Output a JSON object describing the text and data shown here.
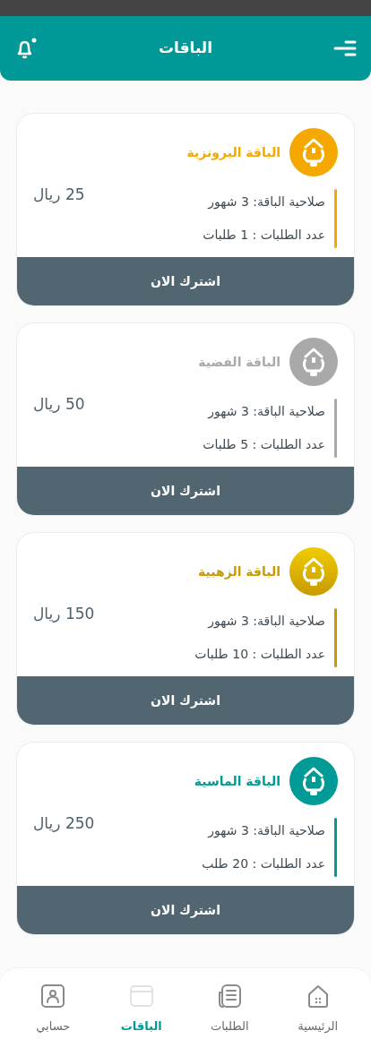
{
  "header": {
    "title": "الباقات"
  },
  "packages": [
    {
      "name": "الباقة البرونزية",
      "color": "#f5a800",
      "price": "25 ريال",
      "validity": "صلاحية الباقة: 3 شهور",
      "requests": "عدد الطلبات : 1 طلبات",
      "button": "اشترك الان"
    },
    {
      "name": "الباقة الفضية",
      "color": "#a9a9a9",
      "price": "50 ريال",
      "validity": "صلاحية الباقة: 3 شهور",
      "requests": "عدد الطلبات : 5 طلبات",
      "button": "اشترك الان"
    },
    {
      "name": "الباقة الزهبية",
      "color": "#c89a00",
      "price": "150 ريال",
      "validity": "صلاحية الباقة: 3 شهور",
      "requests": "عدد الطلبات : 10 طلبات",
      "button": "اشترك الان"
    },
    {
      "name": "الباقة الماسية",
      "color": "#009b96",
      "price": "250 ريال",
      "validity": "صلاحية الباقة: 3 شهور",
      "requests": "عدد الطلبات : 20 طلب",
      "button": "اشترك الان"
    }
  ],
  "nav": [
    {
      "kind": "home",
      "label": "الرئيسية",
      "selected": false
    },
    {
      "kind": "orders",
      "label": "الطلبات",
      "selected": false
    },
    {
      "kind": "packages",
      "label": "الباقات",
      "selected": true
    },
    {
      "kind": "account",
      "label": "حسابي",
      "selected": false
    }
  ]
}
